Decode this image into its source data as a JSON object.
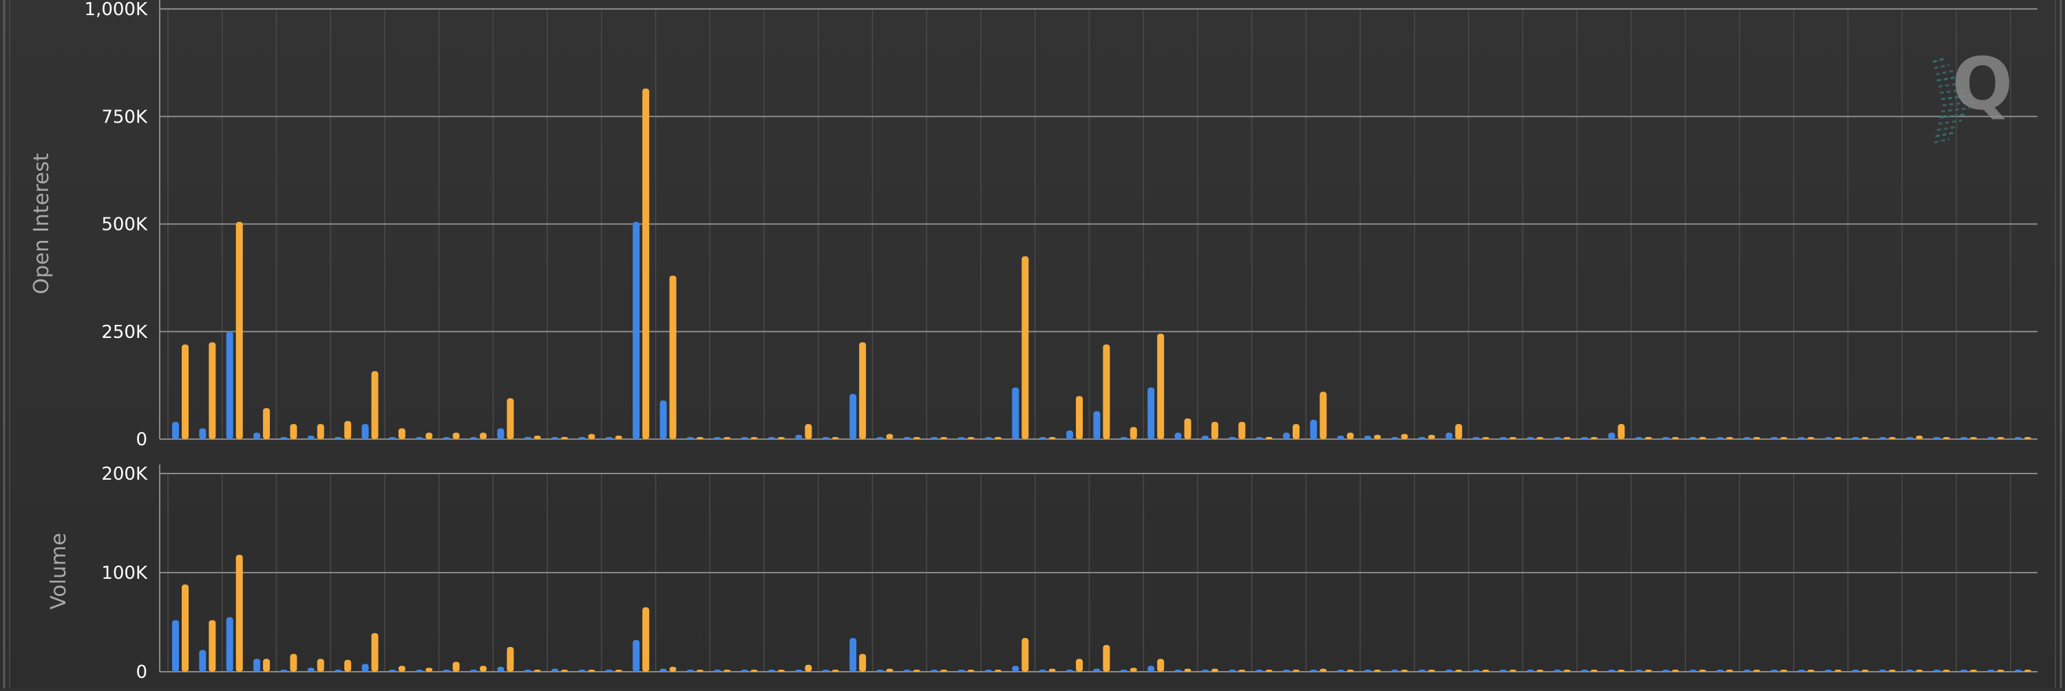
{
  "colors": {
    "background": "#303030",
    "grid": "#8a8a8a",
    "axis_text": "#ffffff",
    "axis_title": "#a8a8a8",
    "series_blue": "#3f86e6",
    "series_orange": "#f6ac3b",
    "logo": "#8c8c8c"
  },
  "logo": {
    "text": "Q",
    "icon": "q-logo-icon"
  },
  "chart_data": [
    {
      "type": "bar",
      "ylabel": "Open Interest",
      "ylim": [
        0,
        1000000
      ],
      "yticks": [
        0,
        250000,
        500000,
        750000,
        1000000
      ],
      "ytick_labels": [
        "0",
        "250K",
        "500K",
        "750K",
        "1,000K"
      ],
      "grid": true,
      "series": [
        {
          "color": "#3f86e6",
          "values": [
            40000,
            25000,
            250000,
            15000,
            2000,
            8000,
            5000,
            35000,
            2000,
            2000,
            2000,
            2000,
            25000,
            5000,
            2000,
            5000,
            2000,
            505000,
            90000,
            1500,
            1000,
            1000,
            1000,
            10000,
            1000,
            105000,
            1000,
            5000,
            1000,
            1000,
            1000,
            120000,
            1000,
            20000,
            65000,
            2000,
            120000,
            15000,
            8000,
            5000,
            2000,
            15000,
            45000,
            8000,
            8000,
            2000,
            5000,
            15000,
            1000,
            1000,
            1000,
            1000,
            1000,
            15000,
            1000,
            1000,
            1000,
            1000,
            1000,
            1000,
            1000,
            1000,
            1000,
            1000,
            1000,
            1000,
            1000,
            5000,
            1000
          ]
        },
        {
          "color": "#f6ac3b",
          "values": [
            220000,
            225000,
            505000,
            72000,
            35000,
            35000,
            42000,
            158000,
            25000,
            15000,
            15000,
            15000,
            95000,
            8000,
            5000,
            12000,
            8000,
            815000,
            380000,
            1000,
            1000,
            1000,
            1000,
            35000,
            1000,
            225000,
            12000,
            2000,
            1000,
            1000,
            5000,
            425000,
            1000,
            100000,
            220000,
            28000,
            245000,
            48000,
            40000,
            40000,
            5000,
            35000,
            110000,
            15000,
            10000,
            12000,
            10000,
            35000,
            1000,
            1000,
            2000,
            1000,
            1000,
            35000,
            5000,
            2000,
            5000,
            2000,
            2000,
            2000,
            2000,
            2000,
            2000,
            2000,
            8000,
            2000,
            2000,
            3000,
            2000
          ]
        }
      ]
    },
    {
      "type": "bar",
      "ylabel": "Volume",
      "ylim": [
        0,
        200000
      ],
      "yticks": [
        0,
        100000,
        200000
      ],
      "ytick_labels": [
        "0",
        "100K",
        "200K"
      ],
      "grid": true,
      "series": [
        {
          "color": "#3f86e6",
          "values": [
            52000,
            22000,
            55000,
            13000,
            1500,
            4000,
            1500,
            8000,
            500,
            500,
            500,
            500,
            5000,
            500,
            3000,
            500,
            500,
            32000,
            3000,
            500,
            500,
            500,
            500,
            500,
            500,
            34000,
            500,
            500,
            500,
            500,
            500,
            6000,
            500,
            2000,
            3000,
            500,
            6000,
            500,
            500,
            500,
            500,
            500,
            500,
            500,
            500,
            500,
            500,
            500,
            500,
            500,
            500,
            500,
            500,
            500,
            500,
            500,
            500,
            500,
            500,
            500,
            500,
            500,
            500,
            500,
            500,
            500,
            500,
            500,
            500
          ]
        },
        {
          "color": "#f6ac3b",
          "values": [
            88000,
            52000,
            118000,
            13000,
            18000,
            13000,
            12000,
            39000,
            6000,
            4000,
            10000,
            6000,
            25000,
            1000,
            1000,
            2000,
            1000,
            65000,
            5000,
            500,
            500,
            500,
            500,
            7000,
            500,
            18000,
            3000,
            500,
            500,
            500,
            2000,
            34000,
            3000,
            13000,
            27000,
            4000,
            13000,
            3000,
            3000,
            500,
            500,
            500,
            3000,
            500,
            500,
            500,
            500,
            500,
            500,
            500,
            500,
            500,
            500,
            500,
            500,
            500,
            500,
            500,
            500,
            500,
            500,
            500,
            500,
            500,
            1000,
            500,
            500,
            500,
            500
          ]
        }
      ]
    }
  ]
}
